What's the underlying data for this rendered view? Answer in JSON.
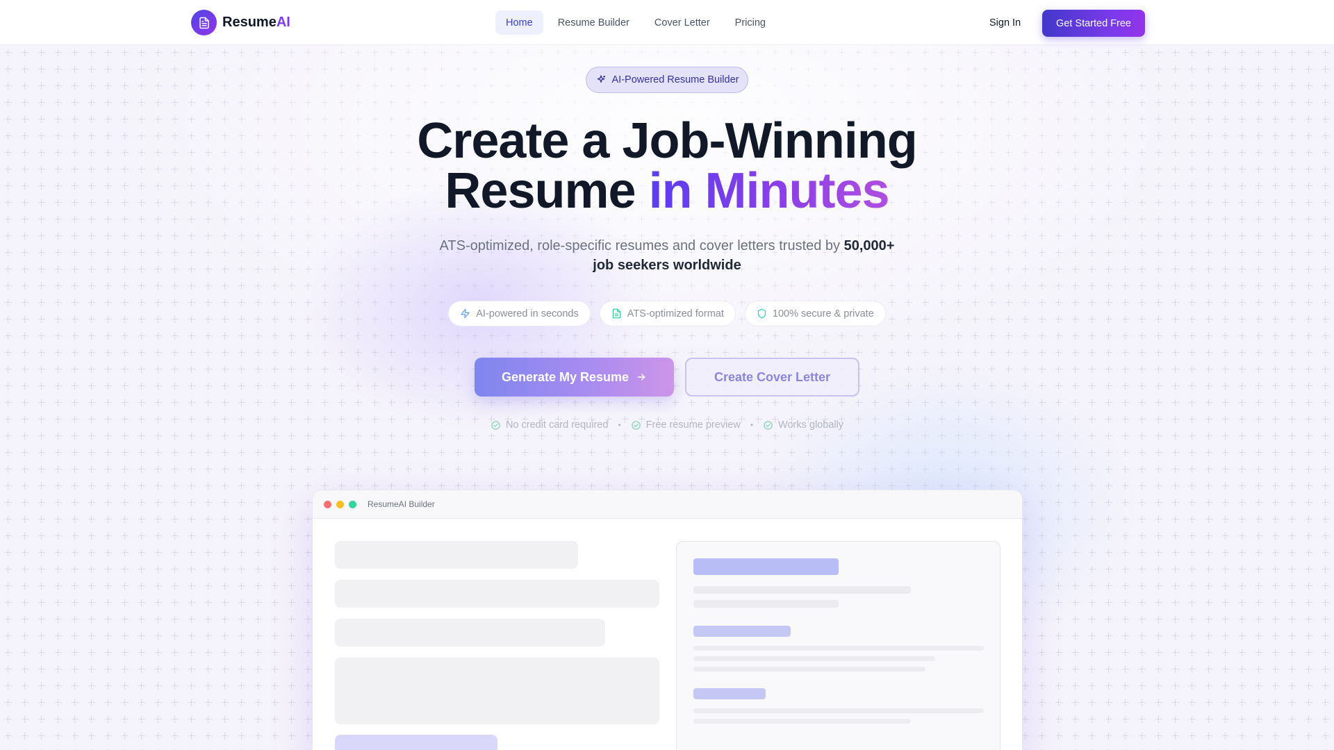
{
  "brand": {
    "name_main": "Resume",
    "name_accent": "AI",
    "icon": "document-icon"
  },
  "nav": {
    "items": [
      {
        "label": "Home",
        "active": true
      },
      {
        "label": "Resume Builder",
        "active": false
      },
      {
        "label": "Cover Letter",
        "active": false
      },
      {
        "label": "Pricing",
        "active": false
      }
    ]
  },
  "header": {
    "sign_in": "Sign In",
    "cta": "Get Started Free"
  },
  "hero": {
    "badge": "AI-Powered Resume Builder",
    "title_line1": "Create a Job-Winning",
    "title_line2_plain": "Resume ",
    "title_line2_accent": "in Minutes",
    "subtitle_plain": "ATS-optimized, role-specific resumes and cover letters trusted by ",
    "subtitle_bold": "50,000+ job seekers worldwide",
    "features": [
      {
        "label": "AI-powered in seconds",
        "icon": "lightning-icon"
      },
      {
        "label": "ATS-optimized format",
        "icon": "document-icon"
      },
      {
        "label": "100% secure & private",
        "icon": "shield-icon"
      }
    ],
    "primary_button": "Generate My Resume",
    "secondary_button": "Create Cover Letter",
    "trust": [
      {
        "label": "No credit card required",
        "icon": "check-circle-icon"
      },
      {
        "label": "Free resume preview",
        "icon": "check-circle-icon"
      },
      {
        "label": "Works globally",
        "icon": "check-circle-icon"
      }
    ]
  },
  "preview_window": {
    "title": "ResumeAI Builder"
  },
  "colors": {
    "primary": "#4f46e5",
    "accent": "#9333ea",
    "window_red": "#f87171",
    "window_yellow": "#fbbf24",
    "window_green": "#34d399"
  }
}
